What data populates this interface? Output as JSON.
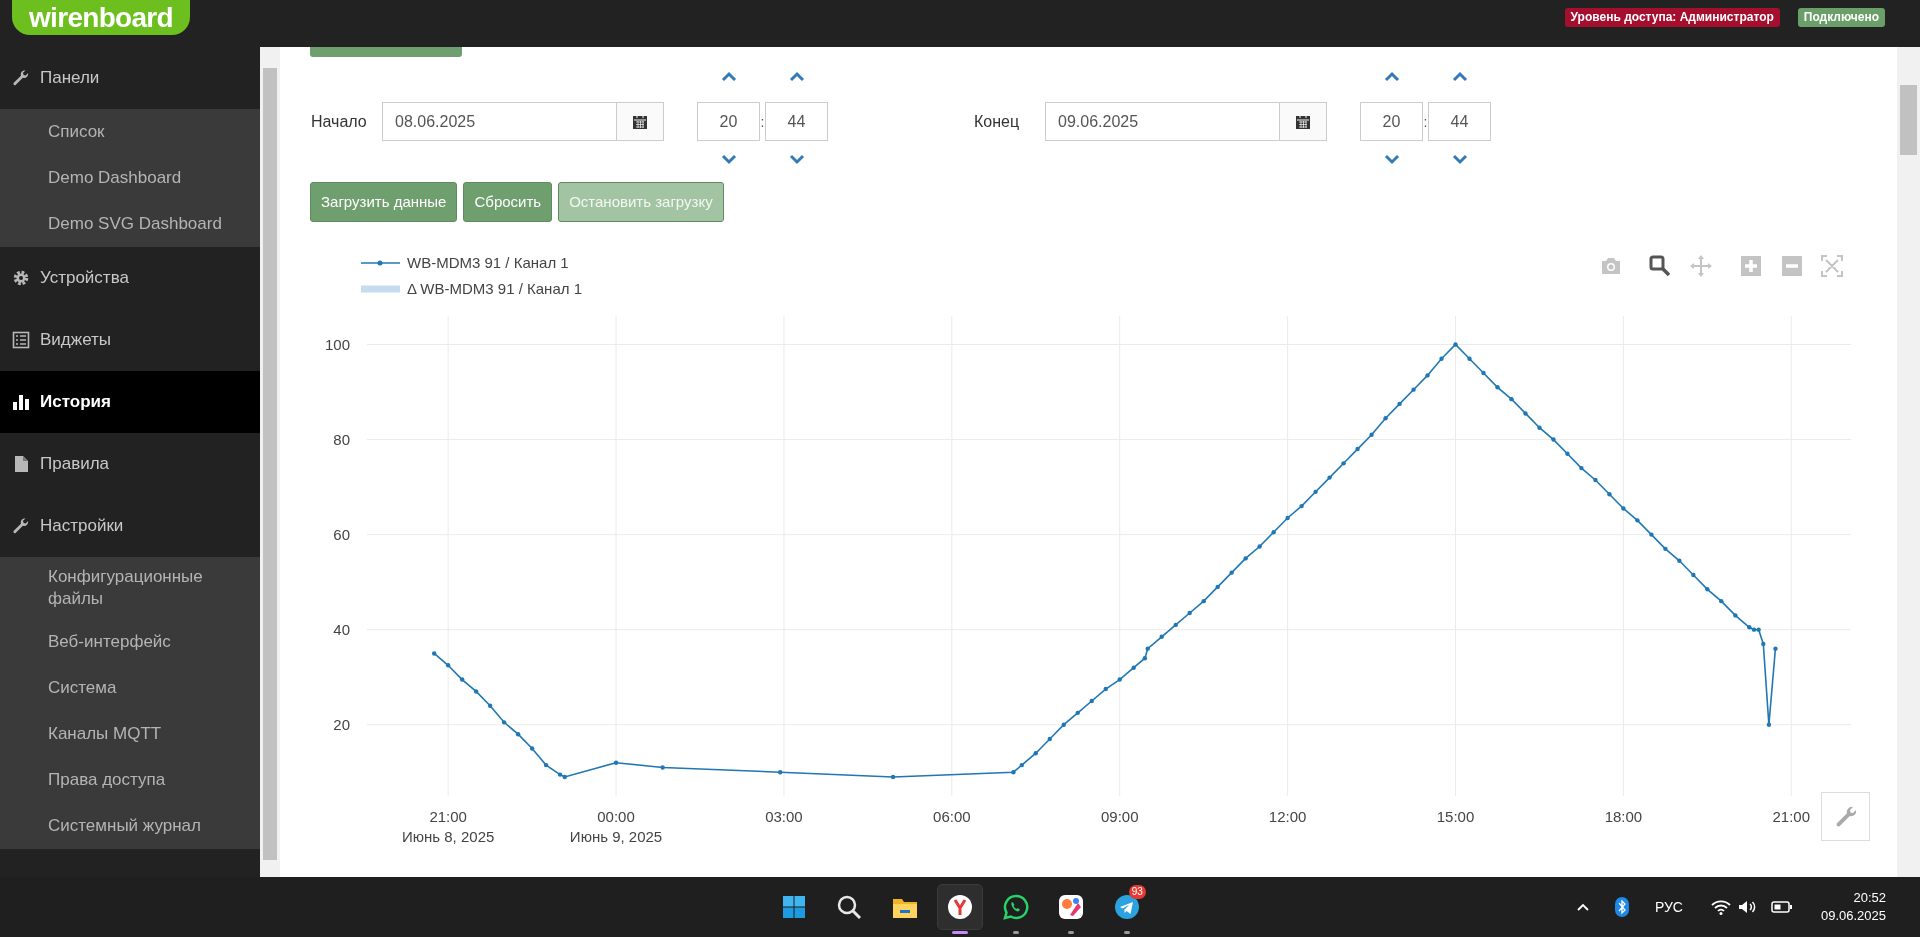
{
  "header": {
    "logo": "wirenboard",
    "badges": [
      {
        "text": "Уровень доступа: Администратор",
        "color": "#a50e2d"
      },
      {
        "text": "Подключено",
        "color": "#6a9f6a"
      }
    ]
  },
  "sidebar": {
    "items": [
      {
        "label": "Панели",
        "kind": "wrench",
        "selected": false,
        "children": [
          {
            "label": "Список",
            "selected": false
          },
          {
            "label": "Demo Dashboard",
            "selected": false
          },
          {
            "label": "Demo SVG Dashboard",
            "selected": false
          }
        ]
      },
      {
        "label": "Устройства",
        "kind": "gear",
        "selected": false
      },
      {
        "label": "Виджеты",
        "kind": "list",
        "selected": false
      },
      {
        "label": "История",
        "kind": "bars",
        "selected": true
      },
      {
        "label": "Правила",
        "kind": "file",
        "selected": false
      },
      {
        "label": "Настройки",
        "kind": "wrench",
        "selected": false,
        "children": [
          {
            "label": "Конфигурационные файлы",
            "selected": false
          },
          {
            "label": "Веб-интерфейс",
            "selected": false
          },
          {
            "label": "Система",
            "selected": false
          },
          {
            "label": "Каналы MQTT",
            "selected": false
          },
          {
            "label": "Права доступа",
            "selected": false
          },
          {
            "label": "Системный журнал",
            "selected": false
          }
        ]
      }
    ]
  },
  "range": [
    {
      "label": "Начало",
      "date": "08.06.2025",
      "hours": "20",
      "separator": ":",
      "minutes": "44"
    },
    {
      "label": "Конец",
      "date": "09.06.2025",
      "hours": "20",
      "separator": ":",
      "minutes": "44"
    }
  ],
  "buttons": [
    {
      "label": "Загрузить данные",
      "disabled": false
    },
    {
      "label": "Сбросить",
      "disabled": false
    },
    {
      "label": "Остановить загрузку",
      "disabled": true
    }
  ],
  "chart": {
    "modebar": [
      {
        "kind": "camera",
        "selected": false
      },
      {
        "kind": "zoom",
        "selected": true
      },
      {
        "kind": "pan",
        "selected": false
      },
      {
        "kind": "zoom-in",
        "selected": false
      },
      {
        "kind": "zoom-out",
        "selected": false
      },
      {
        "kind": "autoscale",
        "selected": false
      }
    ],
    "chart_data": {
      "type": "line",
      "grid": true,
      "xlim": [
        "2025-06-08T19:33",
        "2025-06-09T22:04"
      ],
      "ylim": [
        5,
        106
      ],
      "xticks": [
        {
          "value": "2025-06-08T21:00",
          "label": "21:00\nИюнь 8, 2025"
        },
        {
          "value": "2025-06-09T00:00",
          "label": "00:00\nИюнь 9, 2025"
        },
        {
          "value": "2025-06-09T03:00",
          "label": "03:00"
        },
        {
          "value": "2025-06-09T06:00",
          "label": "06:00"
        },
        {
          "value": "2025-06-09T09:00",
          "label": "09:00"
        },
        {
          "value": "2025-06-09T12:00",
          "label": "12:00"
        },
        {
          "value": "2025-06-09T15:00",
          "label": "15:00"
        },
        {
          "value": "2025-06-09T18:00",
          "label": "18:00"
        },
        {
          "value": "2025-06-09T21:00",
          "label": "21:00"
        }
      ],
      "yticks": [
        20,
        40,
        60,
        80,
        100
      ],
      "x": [
        "2025-06-08T20:45",
        "2025-06-08T21:00",
        "2025-06-08T21:15",
        "2025-06-08T21:30",
        "2025-06-08T21:45",
        "2025-06-08T22:00",
        "2025-06-08T22:15",
        "2025-06-08T22:30",
        "2025-06-08T22:45",
        "2025-06-08T23:00",
        "2025-06-08T23:05",
        "2025-06-09T00:00",
        "2025-06-09T00:50",
        "2025-06-09T02:56",
        "2025-06-09T04:57",
        "2025-06-09T07:06",
        "2025-06-09T07:15",
        "2025-06-09T07:30",
        "2025-06-09T07:45",
        "2025-06-09T08:00",
        "2025-06-09T08:15",
        "2025-06-09T08:30",
        "2025-06-09T08:45",
        "2025-06-09T09:00",
        "2025-06-09T09:15",
        "2025-06-09T09:27",
        "2025-06-09T09:30",
        "2025-06-09T09:45",
        "2025-06-09T10:00",
        "2025-06-09T10:15",
        "2025-06-09T10:30",
        "2025-06-09T10:45",
        "2025-06-09T11:00",
        "2025-06-09T11:15",
        "2025-06-09T11:30",
        "2025-06-09T11:45",
        "2025-06-09T12:00",
        "2025-06-09T12:15",
        "2025-06-09T12:30",
        "2025-06-09T12:45",
        "2025-06-09T13:00",
        "2025-06-09T13:15",
        "2025-06-09T13:30",
        "2025-06-09T13:45",
        "2025-06-09T14:00",
        "2025-06-09T14:15",
        "2025-06-09T14:30",
        "2025-06-09T14:45",
        "2025-06-09T15:00",
        "2025-06-09T15:15",
        "2025-06-09T15:30",
        "2025-06-09T15:45",
        "2025-06-09T16:00",
        "2025-06-09T16:15",
        "2025-06-09T16:30",
        "2025-06-09T16:45",
        "2025-06-09T17:00",
        "2025-06-09T17:15",
        "2025-06-09T17:30",
        "2025-06-09T17:45",
        "2025-06-09T18:00",
        "2025-06-09T18:15",
        "2025-06-09T18:30",
        "2025-06-09T18:45",
        "2025-06-09T19:00",
        "2025-06-09T19:15",
        "2025-06-09T19:30",
        "2025-06-09T19:45",
        "2025-06-09T20:00",
        "2025-06-09T20:15",
        "2025-06-09T20:20",
        "2025-06-09T20:25",
        "2025-06-09T20:30",
        "2025-06-09T20:36",
        "2025-06-09T20:43"
      ],
      "series": [
        {
          "name": "WB-MDM3 91 / Канал 1",
          "color": "#1f77b4",
          "values": [
            35,
            32.5,
            29.5,
            27,
            24,
            20.5,
            18,
            15,
            11.5,
            9.5,
            9,
            12,
            11,
            10,
            9,
            10,
            11.5,
            14,
            17,
            20,
            22.5,
            25,
            27.5,
            29.5,
            32,
            34,
            36,
            38.5,
            41,
            43.5,
            46,
            49,
            52,
            55,
            57.5,
            60.5,
            63.5,
            66,
            69,
            72,
            75,
            78,
            81,
            84.5,
            87.5,
            90.5,
            93.5,
            97,
            100,
            97,
            94,
            91,
            88.5,
            85.5,
            82.5,
            80,
            77,
            74,
            71.5,
            68.5,
            65.5,
            63,
            60,
            57,
            54.5,
            51.5,
            48.5,
            46,
            43,
            40.5,
            40,
            40,
            37,
            20,
            36
          ]
        },
        {
          "name": "Δ WB-MDM3 91 / Канал 1",
          "color": "#c6dbef",
          "values": [
            null,
            null,
            null,
            null,
            null,
            null,
            null,
            null,
            null,
            null,
            null,
            null,
            null,
            null,
            null,
            null,
            null,
            null,
            null,
            null,
            null,
            null,
            null,
            null,
            null,
            null,
            null,
            null,
            null,
            null,
            null,
            null,
            null,
            null,
            null,
            null,
            null,
            null,
            null,
            null,
            null,
            null,
            null,
            null,
            null,
            null,
            null,
            null,
            null,
            null,
            null,
            null,
            null,
            null,
            null,
            null,
            null,
            null,
            null,
            null,
            null,
            null,
            null,
            null,
            null,
            null,
            null,
            null,
            null,
            null,
            null,
            null,
            null,
            null,
            null
          ]
        }
      ]
    }
  },
  "taskbar": {
    "apps": [
      {
        "kind": "windows",
        "active": false,
        "running": false
      },
      {
        "kind": "search",
        "active": false,
        "running": false
      },
      {
        "kind": "folder",
        "active": false,
        "running": false
      },
      {
        "kind": "browser",
        "active": true,
        "running": true
      },
      {
        "kind": "whatsapp",
        "active": false,
        "running": true
      },
      {
        "kind": "shapes",
        "active": false,
        "running": true
      },
      {
        "kind": "telegram",
        "active": false,
        "running": true,
        "badge": "93"
      }
    ],
    "tray": {
      "language": "РУС",
      "time": "20:52",
      "date": "09.06.2025"
    }
  }
}
